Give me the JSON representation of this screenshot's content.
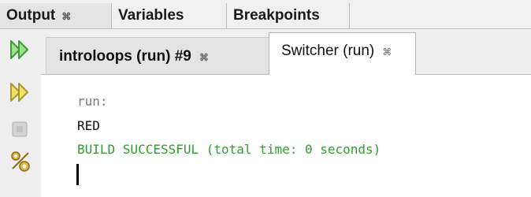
{
  "top_tabs": [
    {
      "label": "Output",
      "close": "⌘"
    },
    {
      "label": "Variables"
    },
    {
      "label": "Breakpoints"
    }
  ],
  "console_tabs": [
    {
      "label": "introloops (run) #9",
      "close": "⌘"
    },
    {
      "label": "Switcher (run)",
      "close": "⌘"
    }
  ],
  "toolbar": {
    "icons": [
      "rerun-icon",
      "rerun-with-params-icon",
      "stop-icon",
      "settings-icon"
    ]
  },
  "console": {
    "lines": [
      "run:",
      "RED",
      "BUILD SUCCESSFUL (total time: 0 seconds)"
    ]
  },
  "colors": {
    "success_text": "#2f9e2f",
    "rerun_icon": "#54b848",
    "stop_icon": "#c9c9c9",
    "settings_icon": "#d7a52a"
  }
}
